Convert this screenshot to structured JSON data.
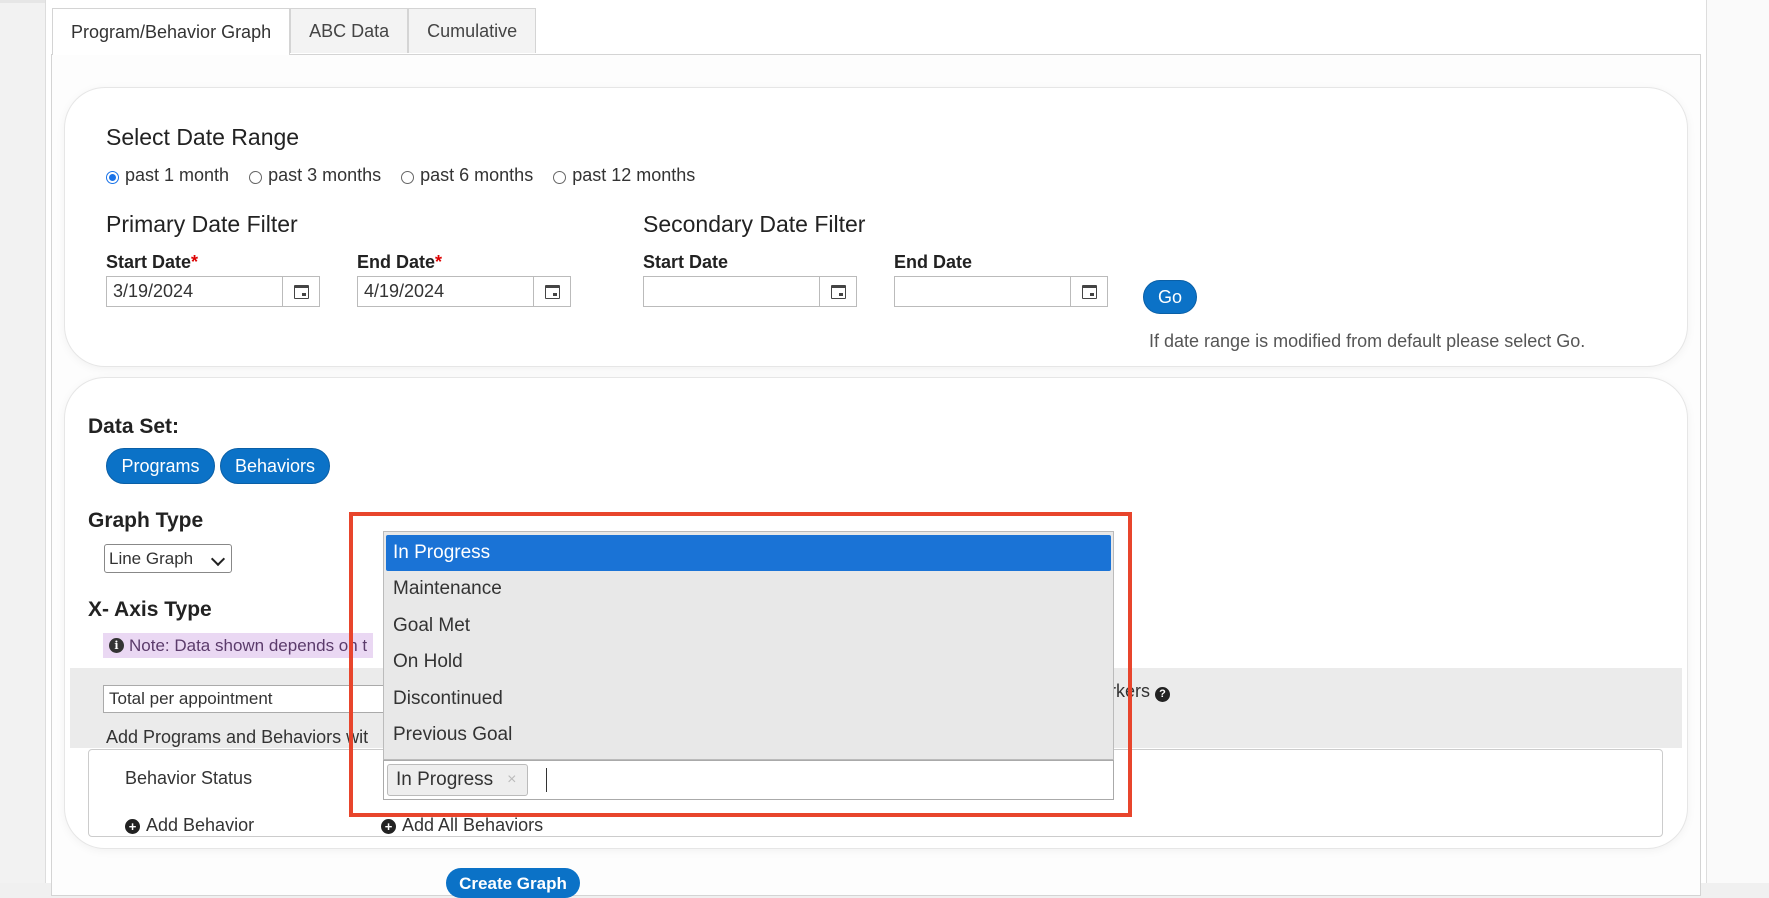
{
  "tabs": [
    {
      "label": "Program/Behavior Graph"
    },
    {
      "label": "ABC Data"
    },
    {
      "label": "Cumulative"
    }
  ],
  "date_range": {
    "title": "Select Date Range",
    "options": [
      "past 1 month",
      "past 3 months",
      "past 6 months",
      "past 12 months"
    ],
    "selected": "past 1 month",
    "primary": {
      "title": "Primary Date Filter",
      "start_label": "Start Date",
      "end_label": "End Date",
      "required_mark": "*",
      "start_value": "3/19/2024",
      "end_value": "4/19/2024"
    },
    "secondary": {
      "title": "Secondary Date Filter",
      "start_label": "Start Date",
      "end_label": "End Date",
      "start_value": "",
      "end_value": ""
    },
    "go_label": "Go",
    "hint": "If date range is modified from default please select Go."
  },
  "data_set": {
    "title": "Data Set:",
    "buttons": [
      "Programs",
      "Behaviors"
    ]
  },
  "graph_type": {
    "title": "Graph Type",
    "value": "Line Graph"
  },
  "x_axis": {
    "title": "X- Axis Type",
    "note": "Note: Data shown depends on t",
    "value": "Total per appointment",
    "markers_text": "arkers",
    "add_text": "Add Programs and Behaviors wit"
  },
  "behavior": {
    "status_label": "Behavior Status",
    "add_behavior": "Add Behavior",
    "add_all": "Add All Behaviors"
  },
  "status_dropdown": {
    "options": [
      "In Progress",
      "Maintenance",
      "Goal Met",
      "On Hold",
      "Discontinued",
      "Previous Goal"
    ],
    "highlighted": "In Progress",
    "selected_tag": "In Progress",
    "remove_symbol": "×"
  },
  "create_button": "Create Graph",
  "colors": {
    "accent": "#0b72c7",
    "highlight_border": "#e8452c",
    "option_selected": "#1a73d6"
  }
}
